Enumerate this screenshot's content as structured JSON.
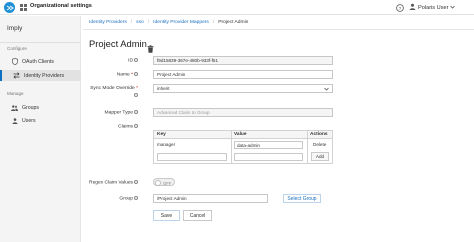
{
  "header": {
    "app_title": "Organizational settings",
    "user_name": "Polaris User"
  },
  "sidebar": {
    "realm": "Imply",
    "sections": [
      {
        "label": "Configure",
        "items": [
          {
            "label": "OAuth Clients",
            "icon": "shield-icon"
          },
          {
            "label": "Identity Providers",
            "icon": "exchange-icon",
            "active": true
          }
        ]
      },
      {
        "label": "Manage",
        "items": [
          {
            "label": "Groups",
            "icon": "users-icon"
          },
          {
            "label": "Users",
            "icon": "user-icon"
          }
        ]
      }
    ]
  },
  "breadcrumb": [
    "Identity Providers",
    "sso",
    "Identity Provider Mappers",
    "Project Admin"
  ],
  "page": {
    "title": "Project Admin"
  },
  "form": {
    "id": {
      "label": "ID",
      "value": "f9d15839-367e-480b-933f-f51"
    },
    "name": {
      "label": "Name",
      "required": "*",
      "value": "Project Admin"
    },
    "sync_mode": {
      "label": "Sync Mode Override",
      "required": "*",
      "value": "inherit"
    },
    "mapper_type": {
      "label": "Mapper Type",
      "value": "Advanced Claim to Group"
    },
    "claims": {
      "label": "Claims",
      "columns": [
        "Key",
        "Value",
        "Actions"
      ],
      "rows": [
        {
          "key": "manager",
          "value": "data-admin",
          "action": "Delete"
        }
      ],
      "add_label": "Add"
    },
    "regex": {
      "label": "Regex Claim Values",
      "state": "OFF"
    },
    "group": {
      "label": "Group",
      "value": "/Project Admin",
      "button": "Select Group"
    },
    "save_label": "Save",
    "cancel_label": "Cancel"
  },
  "colors": {
    "accent": "#1f8fd6",
    "link": "#1b6fbf",
    "sidebar_bg": "#f4f4f4"
  }
}
